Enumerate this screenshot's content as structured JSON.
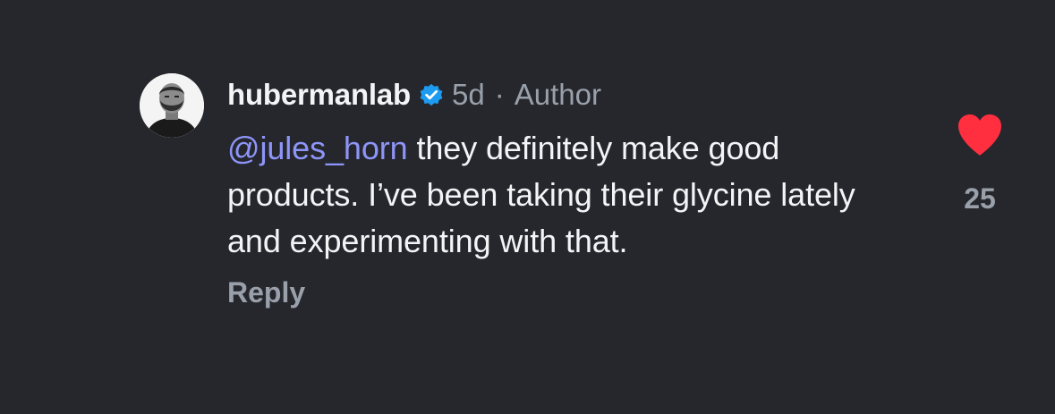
{
  "comment": {
    "username": "hubermanlab",
    "verified_icon": "verified-badge-icon",
    "age": "5d",
    "separator": "·",
    "role": "Author",
    "mention": "@jules_horn",
    "text": " they definitely make good products. I’ve been taking their glycine lately and experimenting with that.",
    "reply_label": "Reply",
    "like_icon": "heart-filled-icon",
    "like_count": "25"
  },
  "colors": {
    "background": "#25272d",
    "text": "#f3f4f6",
    "muted": "#9aa0aa",
    "mention": "#8e95f8",
    "verified": "#1d9bf0",
    "like": "#ff2f40"
  }
}
